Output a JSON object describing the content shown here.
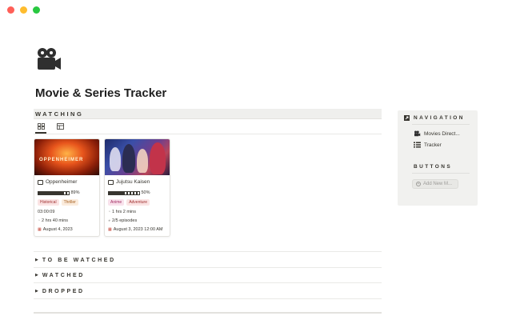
{
  "page": {
    "title": "Movie & Series Tracker",
    "icon": "movie-camera-icon"
  },
  "watching": {
    "heading": "WATCHING",
    "views": [
      "gallery-view-icon",
      "table-view-icon"
    ],
    "cards": [
      {
        "title": "Oppenheimer",
        "cover_text": "OPPENHEIMER",
        "progress": 0.89,
        "progress_label": "89%",
        "tags": [
          {
            "label": "Historical",
            "color": "#fbe4e4"
          },
          {
            "label": "Thriller",
            "color": "#fbecdd"
          }
        ],
        "runtime_field": "03:00:09",
        "duration": "2 hrs 40 mins",
        "date": "August 4, 2023"
      },
      {
        "title": "Jujutsu Kaisen",
        "progress": 0.5,
        "progress_label": "50%",
        "tags": [
          {
            "label": "Anime",
            "color": "#f9e2ec"
          },
          {
            "label": "Adventure",
            "color": "#fbe4e4"
          }
        ],
        "duration": "1 hrs 2 mins",
        "episodes": "2/5 episodes",
        "date": "August 3, 2023 12:00 AM"
      }
    ]
  },
  "toggles": [
    {
      "label": "TO BE WATCHED"
    },
    {
      "label": "WATCHED"
    },
    {
      "label": "DROPPED"
    }
  ],
  "sidebar": {
    "navigation_heading": "NAVIGATION",
    "nav_items": [
      {
        "label": "Movies Direct...",
        "icon": "movie-camera-icon"
      },
      {
        "label": "Tracker",
        "icon": "list-icon"
      }
    ],
    "buttons_heading": "BUTTONS",
    "add_button_label": "Add New M..."
  }
}
